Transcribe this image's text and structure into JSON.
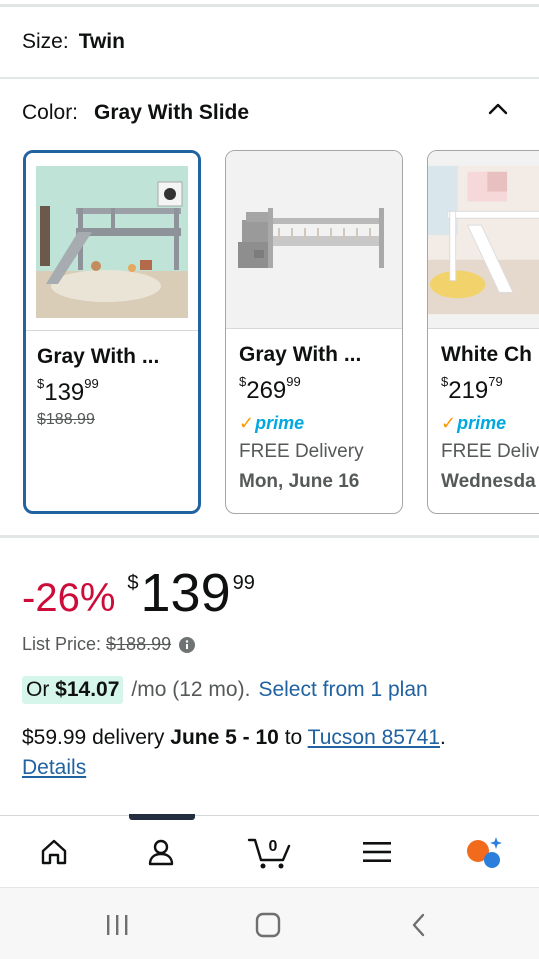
{
  "size": {
    "label": "Size:",
    "value": "Twin"
  },
  "color": {
    "label": "Color:",
    "value": "Gray With Slide"
  },
  "swatches": [
    {
      "title": "Gray With ...",
      "price_symbol": "$",
      "price_whole": "139",
      "price_fraction": "99",
      "list_price": "$188.99",
      "selected": true
    },
    {
      "title": "Gray With ...",
      "price_symbol": "$",
      "price_whole": "269",
      "price_fraction": "99",
      "prime": "prime",
      "delivery_text": "FREE Delivery",
      "delivery_date": "Mon, June 16"
    },
    {
      "title": "White Ch",
      "price_symbol": "$",
      "price_whole": "219",
      "price_fraction": "79",
      "prime": "prime",
      "delivery_text": "FREE Deliv",
      "delivery_date": "Wednesda"
    }
  ],
  "price": {
    "discount": "-26%",
    "symbol": "$",
    "whole": "139",
    "fraction": "99",
    "list_price_label": "List Price:",
    "list_price_value": "$188.99"
  },
  "plan": {
    "prefix": "Or",
    "amount": "$14.07",
    "period": "/mo (12 mo).",
    "link": "Select from 1 plan"
  },
  "delivery": {
    "cost": "$59.99 delivery",
    "dates": "June 5 - 10",
    "to": "to",
    "location": "Tucson 85741",
    "period": ".",
    "details": "Details"
  },
  "colors": {
    "accent_blue": "#2162a1",
    "discount_red": "#cc0c39",
    "prime_blue": "#00a8e1",
    "prime_orange": "#ff9900",
    "plan_highlight": "#d6f5eb"
  },
  "nav": {
    "icons": [
      "home-icon",
      "account-icon",
      "cart-icon",
      "menu-icon",
      "rufus-icon"
    ],
    "cart_count": "0"
  }
}
